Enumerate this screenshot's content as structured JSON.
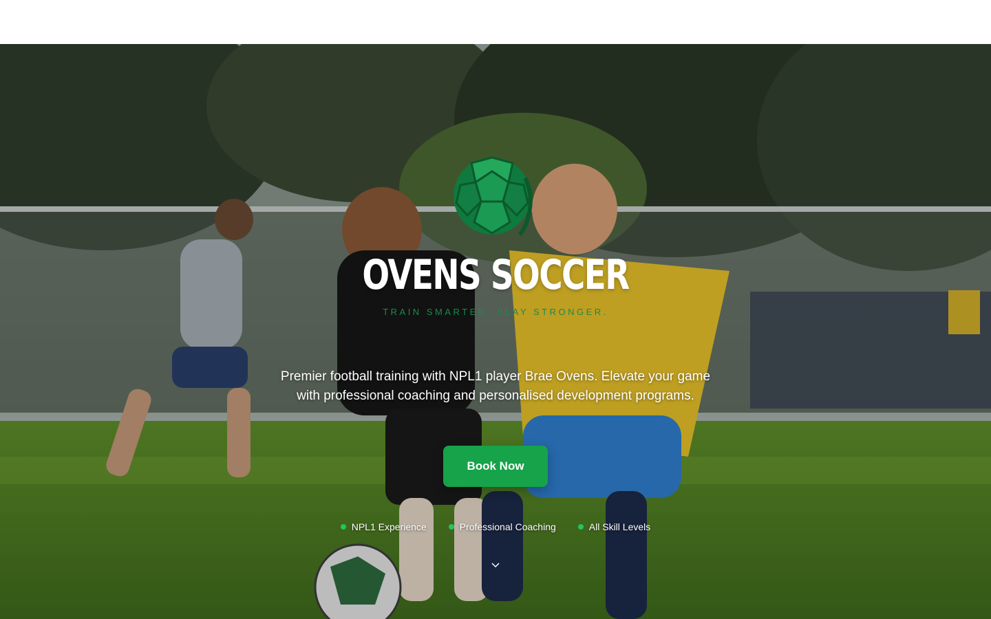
{
  "brand": {
    "title": "OVENS SOCCER",
    "tagline": "TRAIN SMARTER. PLAY STRONGER.",
    "logo_icon": "soccer-ball-icon"
  },
  "hero": {
    "description": "Premier football training with NPL1 player Brae Ovens. Elevate your game with professional coaching and personalised development programs.",
    "cta_label": "Book Now"
  },
  "features": [
    {
      "label": "NPL1 Experience"
    },
    {
      "label": "Professional Coaching"
    },
    {
      "label": "All Skill Levels"
    }
  ],
  "scroll_icon": "chevron-down-icon",
  "colors": {
    "accent": "#16a34a",
    "bullet": "#22c55e",
    "tagline": "#1c8a4a"
  }
}
